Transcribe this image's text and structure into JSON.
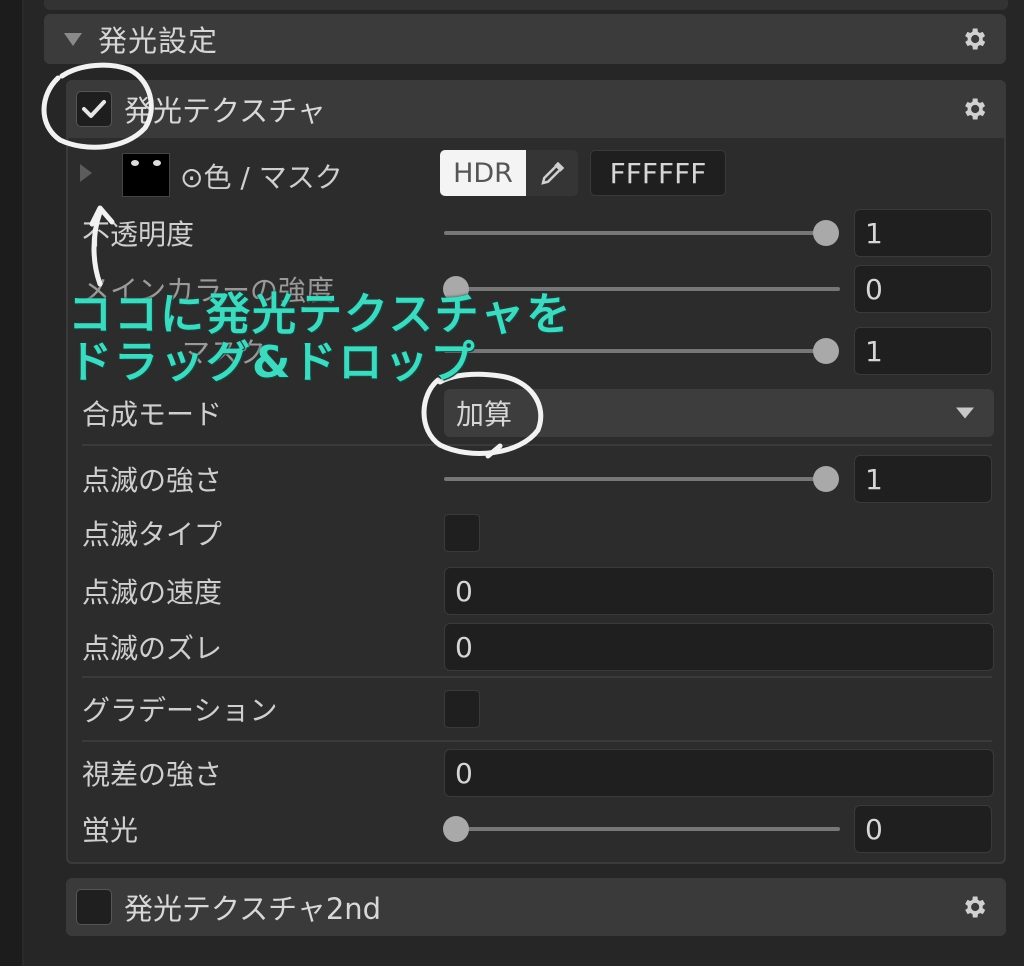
{
  "section": {
    "title": "発光設定"
  },
  "emission_texture": {
    "title": "発光テクスチャ",
    "checked": true,
    "color_mask_label": "⊙色 / マスク",
    "hdr_label": "HDR",
    "hex_value": "FFFFFF"
  },
  "rows": {
    "opacity": {
      "label": "不透明度",
      "value": "1",
      "fraction": 1.0
    },
    "main_color_strength": {
      "label": "メインカラーの強度",
      "value": "0",
      "fraction": 0.0
    },
    "mask": {
      "label": "マスク",
      "value": "1",
      "fraction": 1.0
    },
    "blend_mode": {
      "label": "合成モード",
      "value": "加算"
    },
    "blink_strength": {
      "label": "点滅の強さ",
      "value": "1",
      "fraction": 1.0
    },
    "blink_type": {
      "label": "点滅タイプ",
      "checked": false
    },
    "blink_speed": {
      "label": "点滅の速度",
      "value": "0"
    },
    "blink_offset": {
      "label": "点滅のズレ",
      "value": "0"
    },
    "gradation": {
      "label": "グラデーション",
      "checked": false
    },
    "parallax_strength": {
      "label": "視差の強さ",
      "value": "0"
    },
    "fluorescence": {
      "label": "蛍光",
      "value": "0",
      "fraction": 0.0
    }
  },
  "emission_texture_2nd": {
    "title": "発光テクスチャ2nd",
    "checked": false
  },
  "annotation": {
    "line1": "ココに発光テクスチャを",
    "line2": "ドラッグ&ドロップ"
  },
  "colors": {
    "annotation": "#3fd9c0",
    "panel": "#2c2c2c",
    "header": "#3a3a3a"
  }
}
